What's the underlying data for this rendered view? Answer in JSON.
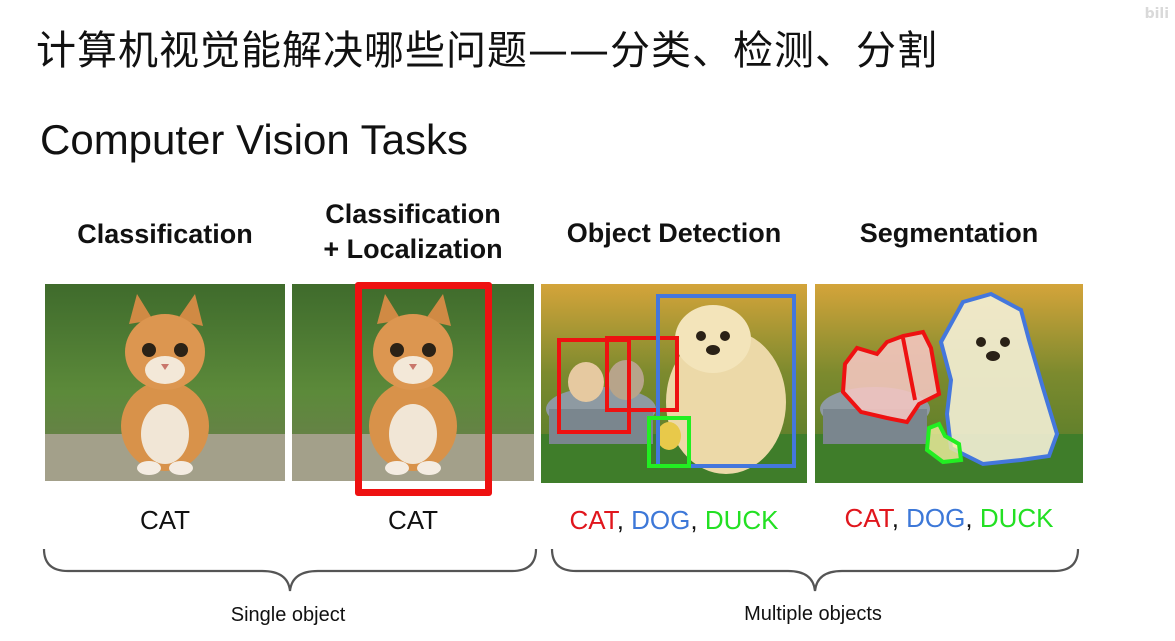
{
  "slide": {
    "zh_title": "计算机视觉能解决哪些问题——分类、检测、分割",
    "watermark": "bili",
    "en_title": "Computer Vision Tasks"
  },
  "columns": [
    {
      "heading_line1": "Classification",
      "heading_line2": "",
      "image": "kitten-photo",
      "label": "CAT"
    },
    {
      "heading_line1": "Classification",
      "heading_line2": "+ Localization",
      "image": "kitten-photo-with-red-bounding-box",
      "label": "CAT"
    },
    {
      "heading_line1": "Object Detection",
      "heading_line2": "",
      "image": "cats-dog-duck-photo-with-bounding-boxes",
      "label_parts": [
        "CAT",
        ", ",
        "DOG",
        ", ",
        "DUCK"
      ]
    },
    {
      "heading_line1": "Segmentation",
      "heading_line2": "",
      "image": "cats-dog-duck-photo-with-segmentation-masks",
      "label_parts": [
        "CAT",
        ", ",
        "DOG",
        ", ",
        "DUCK"
      ]
    }
  ],
  "groups": {
    "single": "Single object",
    "multiple": "Multiple objects"
  },
  "colors": {
    "cat": "#e0161d",
    "dog": "#3d78d8",
    "duck": "#23e023",
    "box_red": "#ee1111"
  }
}
